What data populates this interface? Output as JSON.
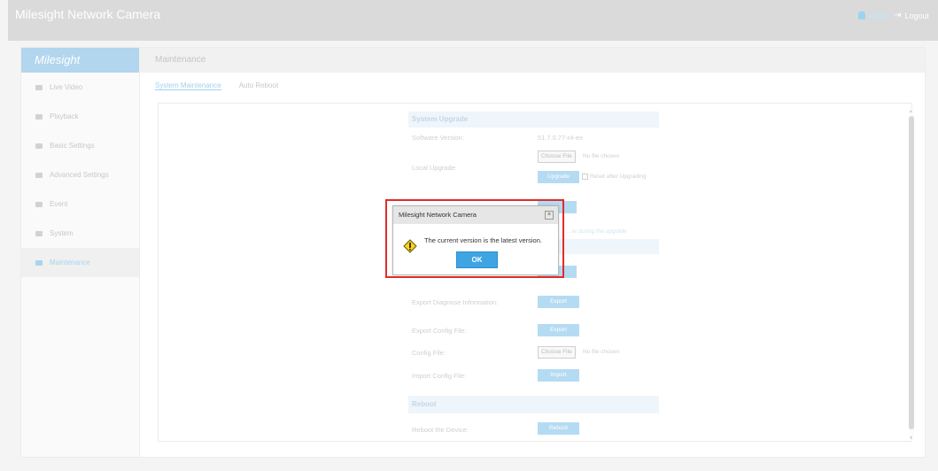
{
  "header": {
    "app_title": "Milesight Network Camera",
    "user": "admin",
    "logout": "Logout"
  },
  "sidebar": {
    "logo": "Milesight",
    "items": [
      {
        "label": "Live Video"
      },
      {
        "label": "Playback"
      },
      {
        "label": "Basic Settings"
      },
      {
        "label": "Advanced Settings"
      },
      {
        "label": "Event"
      },
      {
        "label": "System"
      },
      {
        "label": "Maintenance"
      }
    ]
  },
  "main": {
    "section_title": "Maintenance",
    "tabs": [
      {
        "label": "System Maintenance"
      },
      {
        "label": "Auto Reboot"
      }
    ]
  },
  "upgrade": {
    "header": "System Upgrade",
    "software_version_label": "Software Version:",
    "software_version": "51.7.0.77-r4-ex",
    "local_upgrade_label": "Local Upgrade:",
    "choose_file": "Choose File",
    "no_file": "No file chosen",
    "upgrade_button": "Upgrade",
    "reset_after": "Reset after Upgrading",
    "hint_fragment": "…er during the upgrade"
  },
  "diagnose": {
    "export_info_label": "Export Diagnose Information:",
    "export_button": "Export"
  },
  "config": {
    "export_label": "Export Config File:",
    "export_button": "Export",
    "file_label": "Config File:",
    "choose_file": "Choose File",
    "no_file": "No file chosen",
    "import_label": "Import Config File:",
    "import_button": "Import"
  },
  "reboot": {
    "header": "Reboot",
    "label": "Reboot the Device:",
    "button": "Reboot"
  },
  "dialog": {
    "title": "Milesight Network Camera",
    "message": "The current version is the latest version.",
    "ok": "OK",
    "icon": "warning-icon"
  },
  "colors": {
    "accent": "#3ea4e2",
    "highlight": "#e22b2b"
  }
}
